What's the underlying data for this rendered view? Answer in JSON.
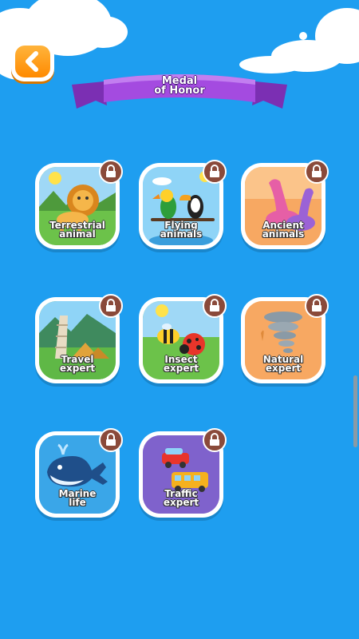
{
  "header": {
    "back_button": {
      "icon": "chevron-left-icon"
    },
    "title": "Medal\nof Honor"
  },
  "medals": [
    {
      "label": "Terrestrial\nanimal",
      "theme": "green",
      "image": "lion",
      "locked": true
    },
    {
      "label": "Flying\nanimals",
      "theme": "blue",
      "image": "birds",
      "locked": true
    },
    {
      "label": "Ancient\nanimals",
      "theme": "orange",
      "image": "dinosaur",
      "locked": true
    },
    {
      "label": "Travel\nexpert",
      "theme": "green",
      "image": "tower-pyramids",
      "locked": true
    },
    {
      "label": "Insect\nexpert",
      "theme": "green",
      "image": "bee-ladybug",
      "locked": true
    },
    {
      "label": "Natural\nexpert",
      "theme": "orange",
      "image": "tornado",
      "locked": true
    },
    {
      "label": "Marine\nlife",
      "theme": "blue",
      "image": "whale",
      "locked": true
    },
    {
      "label": "Traffic\nexpert",
      "theme": "purple",
      "image": "car-bus",
      "locked": true
    }
  ],
  "colors": {
    "background": "#1e9ef0",
    "banner": "#9b3fd6",
    "back_button": "#ff9a1a",
    "lock": "#8a4a3a"
  }
}
